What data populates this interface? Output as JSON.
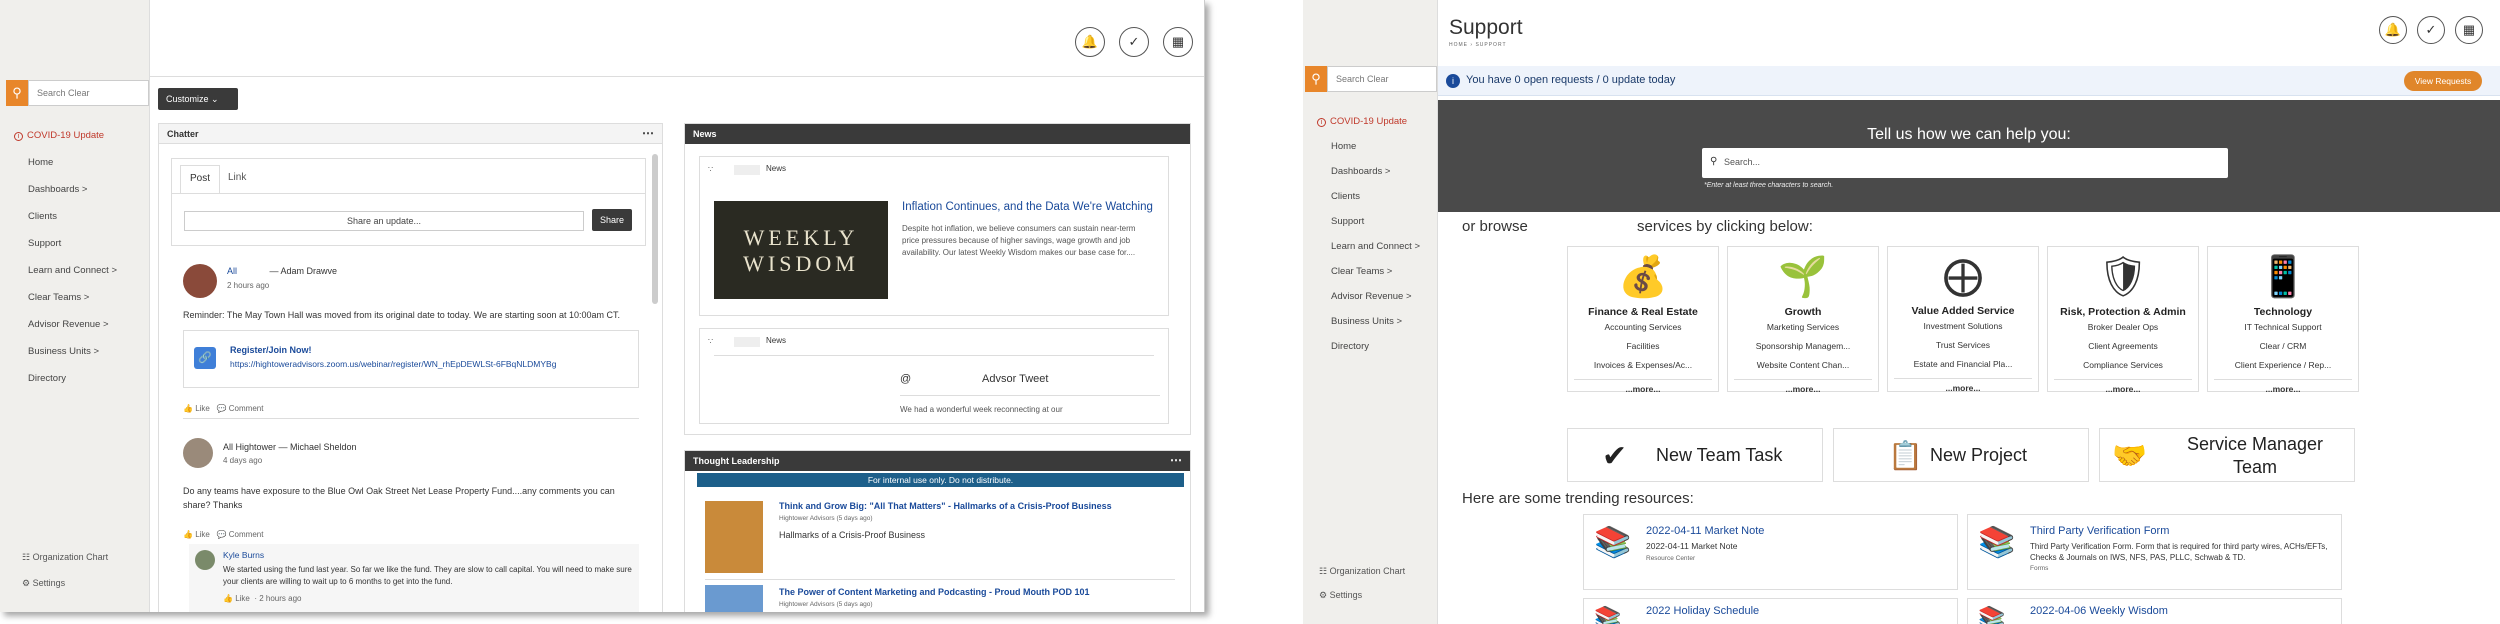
{
  "left": {
    "search": {
      "placeholder": "Search Clear"
    },
    "nav": [
      "COVID-19 Update",
      "Home",
      "Dashboards >",
      "Clients",
      "Support",
      "Learn and Connect >",
      "Clear Teams >",
      "Advisor Revenue >",
      "Business Units >",
      "Directory"
    ],
    "bottom": {
      "org": "Organization Chart",
      "settings": "Settings"
    },
    "customize": "Customize",
    "chatter": {
      "title": "Chatter",
      "tab_post": "Post",
      "tab_link": "Link",
      "share_placeholder": "Share an update...",
      "share_btn": "Share",
      "post1": {
        "to": "All",
        "author": "— Adam Drawve",
        "time": "2 hours ago",
        "text": "Reminder: The May Town Hall was moved from its original date to today. We are starting soon at 10:00am CT.",
        "link_title": "Register/Join Now!",
        "link_url": "https://hightoweradvisors.zoom.us/webinar/register/WN_rhEpDEWLSt-6FBqNLDMYBg",
        "like": "Like",
        "comment": "Comment"
      },
      "post2": {
        "to": "All Hightower — Michael Sheldon",
        "time": "4 days ago",
        "text": "Do any teams have exposure to the Blue Owl Oak Street Net Lease Property Fund....any comments you can share? Thanks",
        "like": "Like",
        "comment": "Comment"
      },
      "reply": {
        "author": "Kyle Burns",
        "text": "We started using the fund last year. So far we like the fund. They are slow to call capital. You will need to make sure your clients are willing to wait up to 6 months to get into the fund.",
        "like": "Like",
        "time": "2 hours ago"
      }
    },
    "news": {
      "title": "News",
      "card1_label": "News",
      "thumb_text": "WEEKLY WISDOM",
      "headline": "Inflation Continues, and the Data We're Watching",
      "summary": "Despite hot inflation, we believe consumers can sustain near-term price pressures because of higher savings, wage growth and job availability. Our latest Weekly Wisdom makes our base case for....",
      "card2_label": "News",
      "tweet_at": "@",
      "tweet_title": "Advsor Tweet",
      "tweet_text": "We had a wonderful week reconnecting at our"
    },
    "thought": {
      "title": "Thought Leadership",
      "banner": "For internal use only. Do not distribute.",
      "item1_title": "Think and Grow Big: \"All That Matters\" - Hallmarks of a Crisis-Proof Business",
      "item1_meta": "Hightower Advisors (5 days ago)",
      "item1_text": "Hallmarks of a Crisis-Proof Business",
      "item2_title": "The Power of Content Marketing and Podcasting - Proud Mouth POD 101",
      "item2_meta": "Hightower Advisors (5 days ago)"
    }
  },
  "right": {
    "title": "Support",
    "breadcrumb": "HOME › SUPPORT",
    "search": {
      "placeholder": "Search Clear"
    },
    "nav": [
      "COVID-19 Update",
      "Home",
      "Dashboards >",
      "Clients",
      "Support",
      "Learn and Connect >",
      "Clear Teams >",
      "Advisor Revenue >",
      "Business Units >",
      "Directory"
    ],
    "bottom": {
      "org": "Organization Chart",
      "settings": "Settings"
    },
    "notice": "You have 0 open requests / 0 update today",
    "view_requests": "View Requests",
    "hero_title": "Tell us how we can help you:",
    "hero_placeholder": "Search...",
    "hero_hint": "*Enter at least three characters to search.",
    "browse_a": "or browse",
    "browse_b": "services by clicking below:",
    "tiles": [
      {
        "title": "Finance & Real Estate",
        "items": [
          "Accounting Services",
          "Facilities",
          "Invoices & Expenses/Ac..."
        ],
        "more": "...more..."
      },
      {
        "title": "Growth",
        "items": [
          "Marketing Services",
          "Sponsorship Managem...",
          "Website Content Chan..."
        ],
        "more": "...more..."
      },
      {
        "title": "Value Added Service",
        "items": [
          "Investment Solutions",
          "Trust Services",
          "Estate and Financial Pla..."
        ],
        "more": "...more..."
      },
      {
        "title": "Risk, Protection & Admin",
        "items": [
          "Broker Dealer Ops",
          "Client Agreements",
          "Compliance Services"
        ],
        "more": "...more..."
      },
      {
        "title": "Technology",
        "items": [
          "IT Technical Support",
          "Clear / CRM",
          "Client Experience / Rep..."
        ],
        "more": "...more..."
      }
    ],
    "actions": [
      "New Team Task",
      "New Project",
      "Service Manager Team"
    ],
    "trending_title": "Here are some trending resources:",
    "resources": [
      {
        "title": "2022-04-11 Market Note",
        "desc": "2022-04-11 Market Note",
        "cat": "Resource Center"
      },
      {
        "title": "Third Party Verification Form",
        "desc": "Third Party Verification Form. Form that is required for third party wires, ACHs/EFTs, Checks & Journals on IWS, NFS, PAS, PLLC, Schwab & TD.",
        "cat": "Forms"
      },
      {
        "title": "2022 Holiday Schedule",
        "desc": "",
        "cat": ""
      },
      {
        "title": "2022-04-06 Weekly Wisdom",
        "desc": "",
        "cat": ""
      }
    ]
  },
  "colors": {
    "orange": "#e8862a",
    "dark": "#3a3a3a",
    "notice_bg": "#eef3fb",
    "link": "#1a4a9a",
    "covid": "#c0392b"
  }
}
